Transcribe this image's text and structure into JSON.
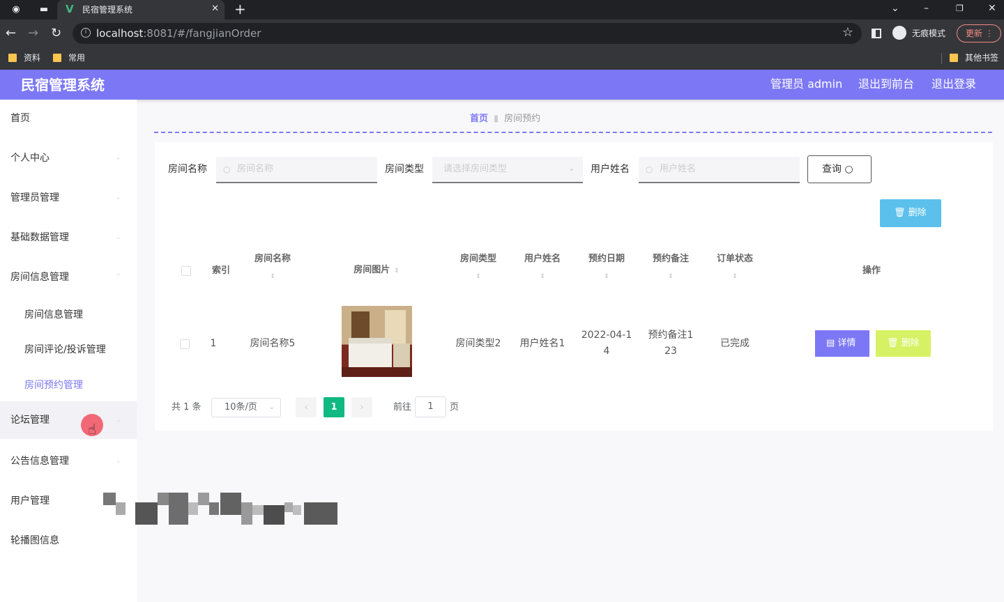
{
  "browser": {
    "tab_title": "民宿管理系统",
    "url_host": "localhost",
    "url_rest": ":8081/#/fangjianOrder",
    "incognito_label": "无痕模式",
    "update_label": "更新",
    "bookmarks": [
      "资料",
      "常用"
    ],
    "other_bookmarks": "其他书签"
  },
  "header": {
    "app_title": "民宿管理系统",
    "user_label": "管理员 admin",
    "to_front": "退出到前台",
    "logout": "退出登录"
  },
  "sidebar": {
    "items": [
      {
        "label": "首页"
      },
      {
        "label": "个人中心"
      },
      {
        "label": "管理员管理"
      },
      {
        "label": "基础数据管理"
      },
      {
        "label": "房间信息管理"
      },
      {
        "label": "房间信息管理"
      },
      {
        "label": "房间评论/投诉管理"
      },
      {
        "label": "房间预约管理"
      },
      {
        "label": "论坛管理"
      },
      {
        "label": "公告信息管理"
      },
      {
        "label": "用户管理"
      },
      {
        "label": "轮播图信息"
      }
    ]
  },
  "breadcrumb": {
    "home": "首页",
    "current": "房间预约"
  },
  "search": {
    "room_name_label": "房间名称",
    "room_name_placeholder": "房间名称",
    "room_type_label": "房间类型",
    "room_type_placeholder": "请选择房间类型",
    "user_name_label": "用户姓名",
    "user_name_placeholder": "用户姓名",
    "query_button": "查询"
  },
  "actions": {
    "batch_delete": "删除"
  },
  "table": {
    "headers": {
      "index": "索引",
      "room_name": "房间名称",
      "room_image": "房间图片",
      "room_type": "房间类型",
      "user_name": "用户姓名",
      "date": "预约日期",
      "remark": "预约备注",
      "status": "订单状态",
      "ops": "操作"
    },
    "rows": [
      {
        "index": "1",
        "room_name": "房间名称5",
        "room_type": "房间类型2",
        "user_name": "用户姓名1",
        "date_line1": "2022-04-1",
        "date_line2": "4",
        "remark_line1": "预约备注1",
        "remark_line2": "23",
        "status": "已完成",
        "detail_button": "详情",
        "delete_button": "删除"
      }
    ]
  },
  "pagination": {
    "total": "共 1 条",
    "page_size": "10条/页",
    "current_page": "1",
    "goto_label": "前往",
    "goto_value": "1",
    "page_unit": "页"
  },
  "colors": {
    "primary": "#7c78f5",
    "batch_delete": "#5bc0eb",
    "detail": "#7c78f5",
    "delete": "#d6f264",
    "active_page": "#10b981"
  }
}
